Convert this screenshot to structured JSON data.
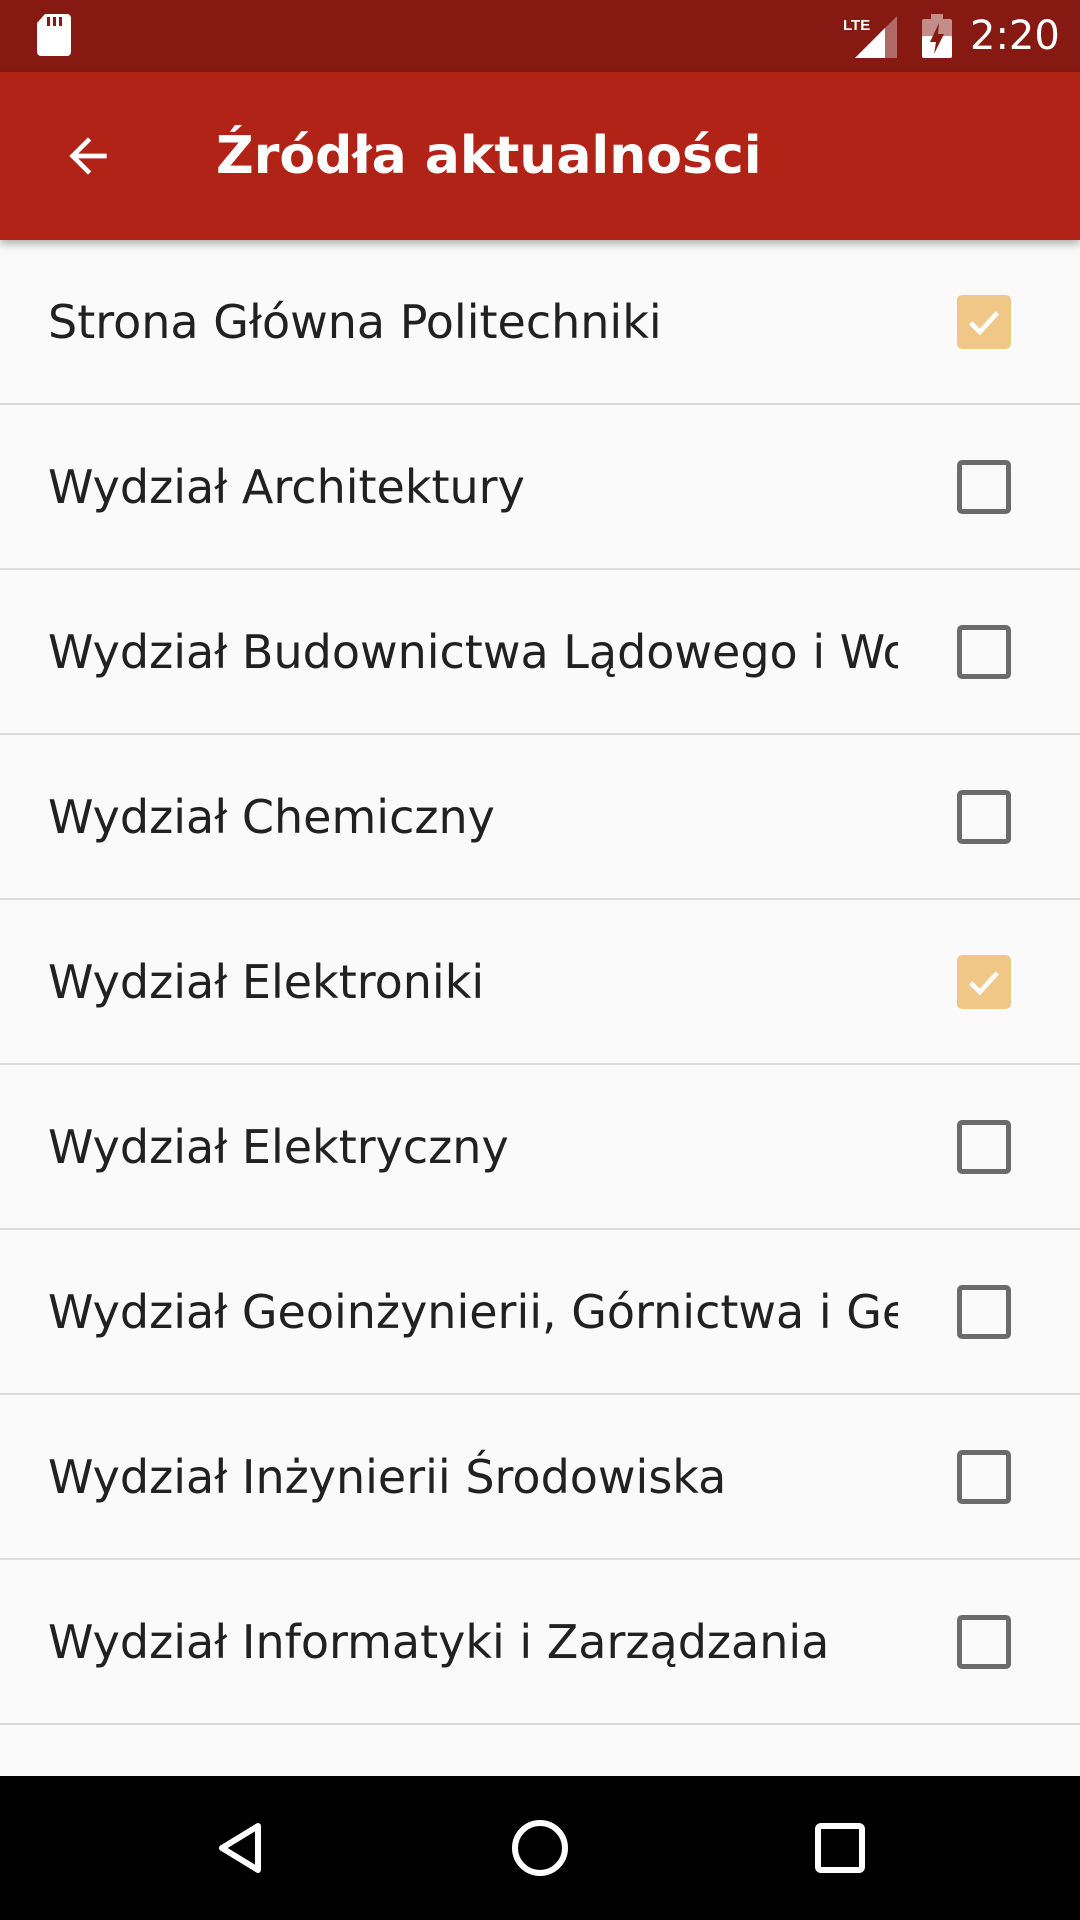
{
  "status_bar": {
    "time": "2:20",
    "network": "LTE",
    "icons": [
      "sd-card-icon",
      "signal-icon",
      "battery-charging-icon"
    ]
  },
  "app_bar": {
    "title": "Źródła aktualności",
    "back_icon": "arrow-back-icon"
  },
  "items": [
    {
      "label": "Strona Główna Politechniki",
      "checked": true
    },
    {
      "label": "Wydział Architektury",
      "checked": false
    },
    {
      "label": "Wydział Budownictwa Lądowego i Wo..",
      "checked": false
    },
    {
      "label": "Wydział Chemiczny",
      "checked": false
    },
    {
      "label": "Wydział Elektroniki",
      "checked": true
    },
    {
      "label": "Wydział Elektryczny",
      "checked": false
    },
    {
      "label": "Wydział Geoinżynierii, Górnictwa i Geo..",
      "checked": false
    },
    {
      "label": "Wydział Inżynierii Środowiska",
      "checked": false
    },
    {
      "label": "Wydział Informatyki i Zarządzania",
      "checked": false
    },
    {
      "label": "",
      "checked": false
    }
  ],
  "colors": {
    "status_bar": "#861a12",
    "app_bar": "#b22317",
    "checkbox_checked": "#f0c787",
    "checkbox_unchecked": "#6b6b6b"
  },
  "nav_bar": {
    "icons": [
      "back-triangle-icon",
      "home-circle-icon",
      "recents-square-icon"
    ]
  }
}
